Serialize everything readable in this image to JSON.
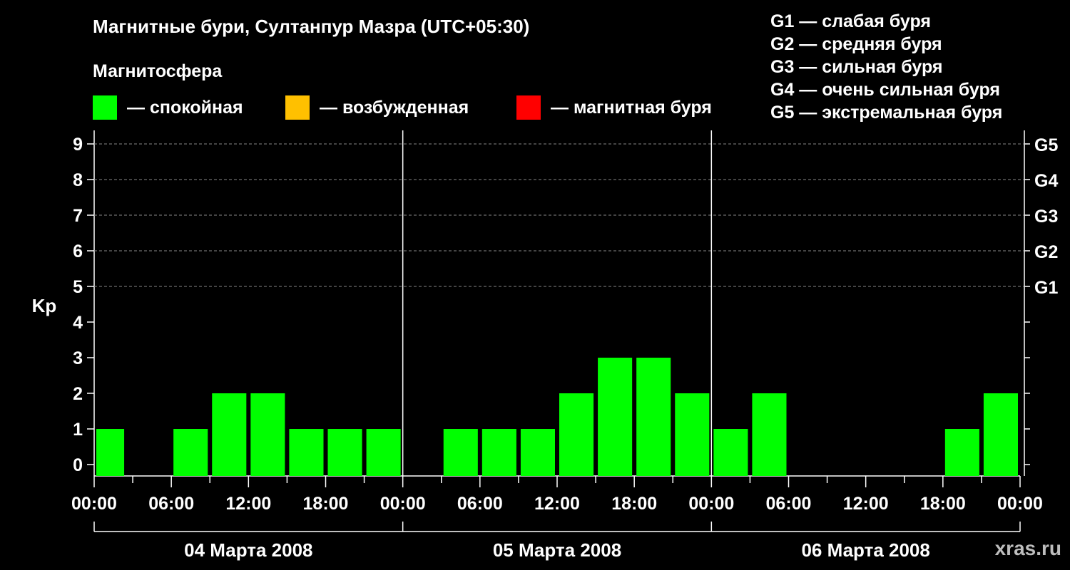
{
  "chart_data": {
    "type": "bar",
    "title": "Магнитные бури, Султанпур Мазра (UTC+05:30)",
    "subtitle": "Магнитосфера",
    "ylabel": "Kp",
    "ylim": [
      0,
      9
    ],
    "yticks": [
      "0",
      "1",
      "2",
      "3",
      "4",
      "5",
      "6",
      "7",
      "8",
      "9"
    ],
    "g_ticks": [
      {
        "label": "G1",
        "kp": 5
      },
      {
        "label": "G2",
        "kp": 6
      },
      {
        "label": "G3",
        "kp": 7
      },
      {
        "label": "G4",
        "kp": 8
      },
      {
        "label": "G5",
        "kp": 9
      }
    ],
    "xticks": [
      "00:00",
      "06:00",
      "12:00",
      "18:00",
      "00:00",
      "06:00",
      "12:00",
      "18:00",
      "00:00",
      "06:00",
      "12:00",
      "18:00",
      "00:00"
    ],
    "days": [
      "04 Марта 2008",
      "05 Марта 2008",
      "06 Марта 2008"
    ],
    "grid": true,
    "x_unit_hours_from_start": true,
    "bars": [
      {
        "start": 0,
        "end": 2.5,
        "kp": 1
      },
      {
        "start": 6,
        "end": 9,
        "kp": 1
      },
      {
        "start": 9,
        "end": 12,
        "kp": 2
      },
      {
        "start": 12,
        "end": 15,
        "kp": 2
      },
      {
        "start": 15,
        "end": 18,
        "kp": 1
      },
      {
        "start": 18,
        "end": 21,
        "kp": 1
      },
      {
        "start": 21,
        "end": 24,
        "kp": 1
      },
      {
        "start": 27,
        "end": 30,
        "kp": 1
      },
      {
        "start": 30,
        "end": 33,
        "kp": 1
      },
      {
        "start": 33,
        "end": 36,
        "kp": 1
      },
      {
        "start": 36,
        "end": 39,
        "kp": 2
      },
      {
        "start": 39,
        "end": 42,
        "kp": 3
      },
      {
        "start": 42,
        "end": 45,
        "kp": 3
      },
      {
        "start": 45,
        "end": 48,
        "kp": 2
      },
      {
        "start": 48,
        "end": 51,
        "kp": 1
      },
      {
        "start": 51,
        "end": 54,
        "kp": 2
      },
      {
        "start": 66,
        "end": 69,
        "kp": 1
      },
      {
        "start": 69,
        "end": 72,
        "kp": 2
      }
    ],
    "colors": {
      "quiet": "#00ff00",
      "active": "#ffc000",
      "storm": "#ff0000"
    }
  },
  "legend": {
    "quiet": "— спокойная",
    "active": "— возбужденная",
    "storm": "— магнитная буря"
  },
  "g_legend": [
    "G1 — слабая буря",
    "G2 — средняя буря",
    "G3 — сильная буря",
    "G4 — очень сильная буря",
    "G5 — экстремальная буря"
  ],
  "watermark": "xras.ru"
}
